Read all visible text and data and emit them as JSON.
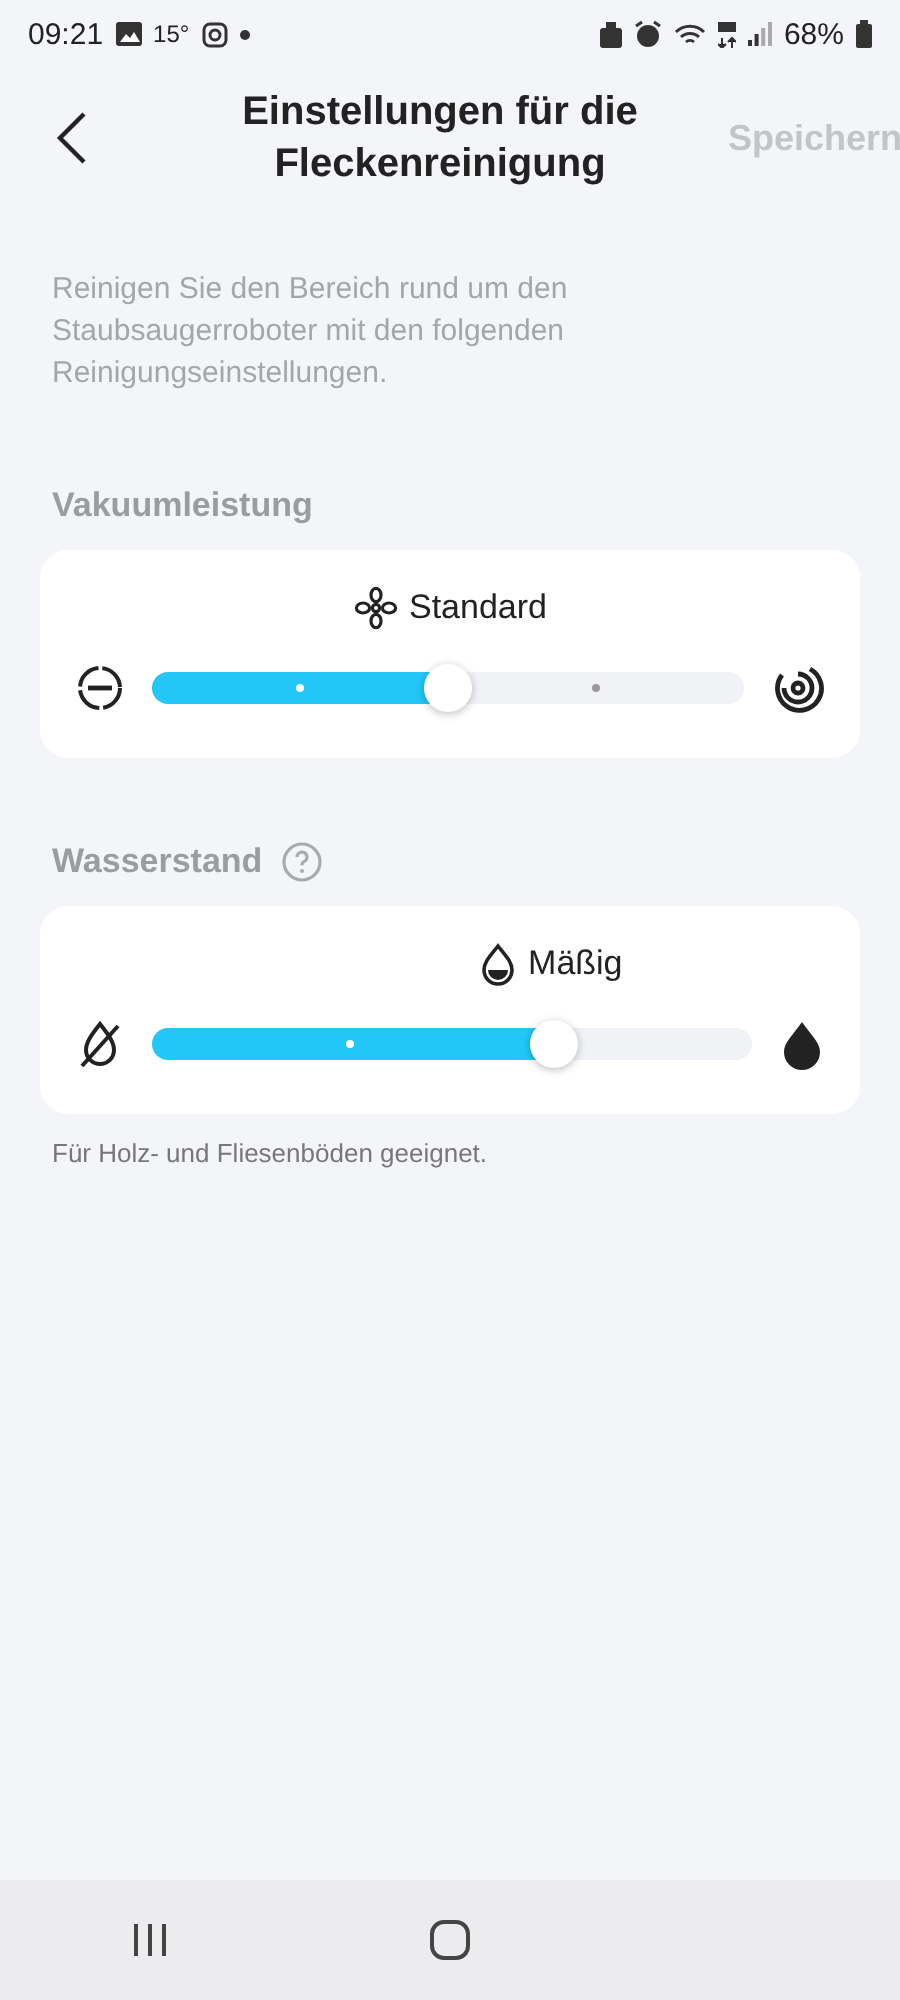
{
  "status_bar": {
    "time": "09:21",
    "temperature": "15°",
    "battery": "68%"
  },
  "header": {
    "title": "Einstellungen für die Fleckenreinigung",
    "action": "Speichern"
  },
  "description": "Reinigen Sie den Bereich rund um den Staubsaugerroboter mit den folgenden Reinigungseinstellungen.",
  "sections": [
    {
      "kind": "suction",
      "title": "Vakuumleistung",
      "help": false,
      "value_label": "Standard",
      "level": 0.5
    },
    {
      "kind": "water",
      "title": "Wasserstand",
      "help": true,
      "value_label": "Mäßig",
      "level": 0.67
    }
  ],
  "hint": "Für Holz- und Fliesenböden geeignet."
}
